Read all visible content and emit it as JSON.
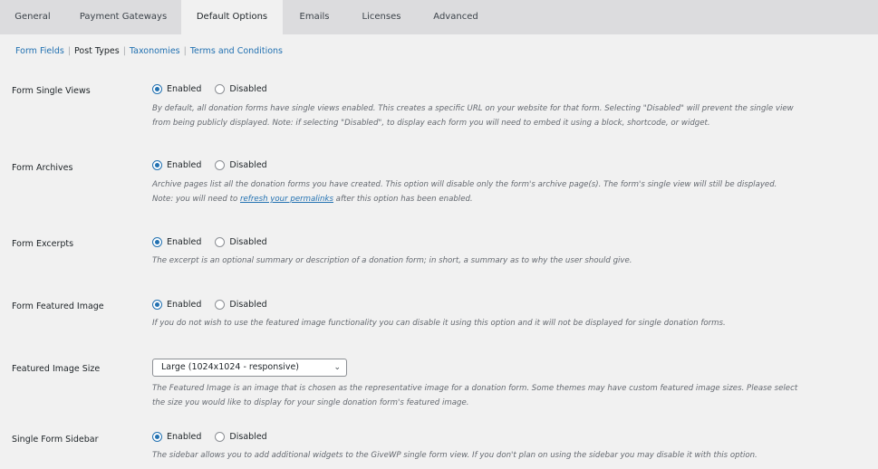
{
  "tabs": [
    {
      "label": "General"
    },
    {
      "label": "Payment Gateways"
    },
    {
      "label": "Default Options",
      "active": true
    },
    {
      "label": "Emails"
    },
    {
      "label": "Licenses"
    },
    {
      "label": "Advanced"
    }
  ],
  "subnav": [
    {
      "label": "Form Fields"
    },
    {
      "label": "Post Types",
      "current": true
    },
    {
      "label": "Taxonomies"
    },
    {
      "label": "Terms and Conditions"
    }
  ],
  "radio_labels": {
    "enabled": "Enabled",
    "disabled": "Disabled"
  },
  "settings": {
    "single_views": {
      "label": "Form Single Views",
      "value": "Enabled",
      "desc1": "By default, all donation forms have single views enabled. This creates a specific URL on your website for that form. Selecting \"Disabled\" will prevent the single view",
      "desc2": "from being publicly displayed. Note: if selecting \"Disabled\", to display each form you will need to embed it using a block, shortcode, or widget."
    },
    "archives": {
      "label": "Form Archives",
      "value": "Enabled",
      "desc1": "Archive pages list all the donation forms you have created. This option will disable only the form's archive page(s). The form's single view will still be displayed.",
      "desc2_pre": "Note: you will need to ",
      "desc2_link": "refresh your permalinks",
      "desc2_post": " after this option has been enabled."
    },
    "excerpts": {
      "label": "Form Excerpts",
      "value": "Enabled",
      "desc1": "The excerpt is an optional summary or description of a donation form; in short, a summary as to why the user should give."
    },
    "featured_image": {
      "label": "Form Featured Image",
      "value": "Enabled",
      "desc1": "If you do not wish to use the featured image functionality you can disable it using this option and it will not be displayed for single donation forms."
    },
    "image_size": {
      "label": "Featured Image Size",
      "selected": "Large (1024x1024 - responsive)",
      "desc1": "The Featured Image is an image that is chosen as the representative image for a donation form. Some themes may have custom featured image sizes. Please select",
      "desc2": "the size you would like to display for your single donation form's featured image."
    },
    "sidebar": {
      "label": "Single Form Sidebar",
      "value": "Enabled",
      "desc1": "The sidebar allows you to add additional widgets to the GiveWP single form view. If you don't plan on using the sidebar you may disable it with this option."
    }
  }
}
